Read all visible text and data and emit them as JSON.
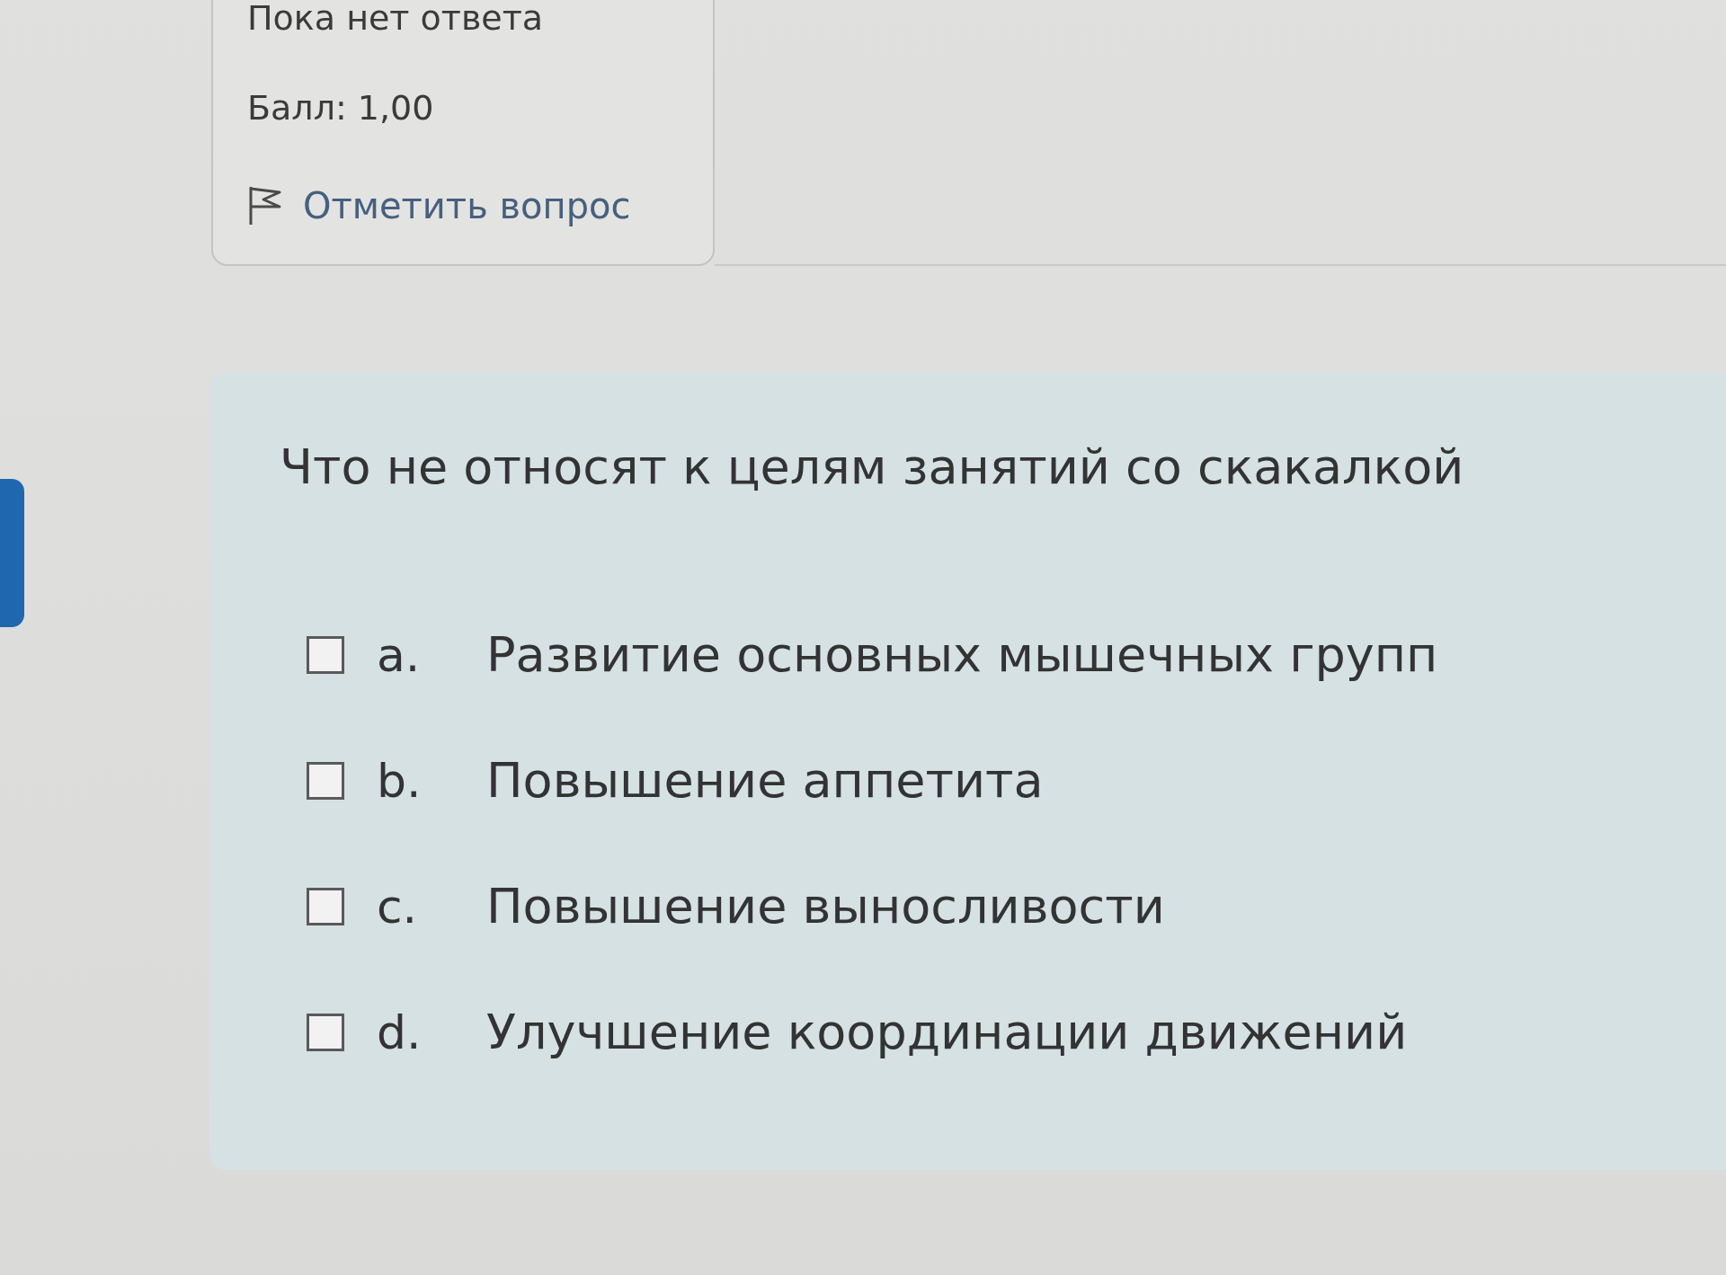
{
  "info": {
    "state": "Пока нет ответа",
    "grade": "Балл: 1,00",
    "flag_link": "Отметить вопрос"
  },
  "question": {
    "text": "Что не относят к целям занятий со скакалкой",
    "options": [
      {
        "letter": "a.",
        "text": "Развитие основных мышечных групп",
        "checked": false
      },
      {
        "letter": "b.",
        "text": "Повышение аппетита",
        "checked": false
      },
      {
        "letter": "c.",
        "text": "Повышение выносливости",
        "checked": false
      },
      {
        "letter": "d.",
        "text": "Улучшение координации движений",
        "checked": false
      }
    ]
  }
}
